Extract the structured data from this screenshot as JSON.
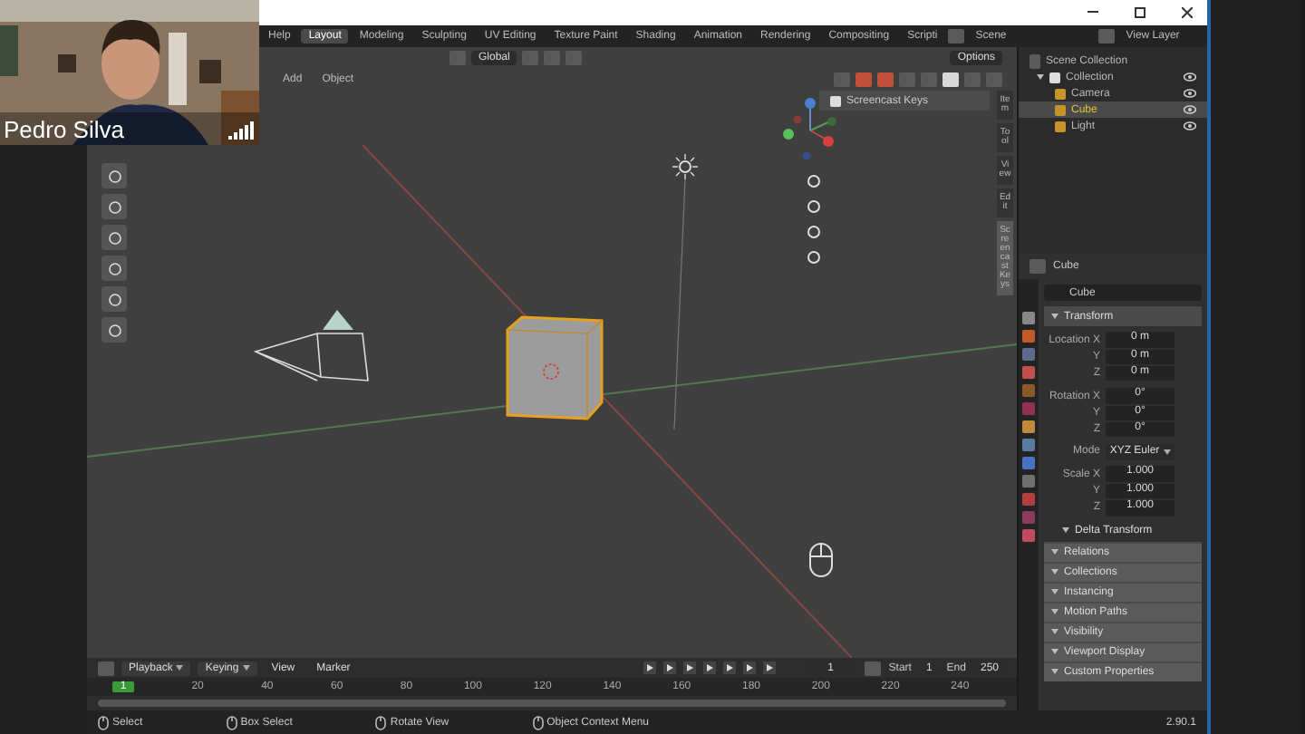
{
  "call": {
    "participant": "Pedro Silva"
  },
  "menu": [
    "Help"
  ],
  "workspaces": [
    {
      "label": "Layout",
      "selected": true
    },
    {
      "label": "Modeling",
      "selected": false
    },
    {
      "label": "Sculpting",
      "selected": false
    },
    {
      "label": "UV Editing",
      "selected": false
    },
    {
      "label": "Texture Paint",
      "selected": false
    },
    {
      "label": "Shading",
      "selected": false
    },
    {
      "label": "Animation",
      "selected": false
    },
    {
      "label": "Rendering",
      "selected": false
    },
    {
      "label": "Compositing",
      "selected": false
    },
    {
      "label": "Scripti",
      "selected": false
    }
  ],
  "scene": "Scene",
  "view_layer": "View Layer",
  "viewport": {
    "orientation": "Global",
    "options": "Options",
    "menu": [
      "Add",
      "Object"
    ],
    "screencast_keys": {
      "label": "Screencast Keys",
      "checked": true
    },
    "sidebar_tabs": [
      {
        "label": "Item",
        "selected": false
      },
      {
        "label": "Tool",
        "selected": false
      },
      {
        "label": "View",
        "selected": false
      },
      {
        "label": "Edit",
        "selected": false
      },
      {
        "label": "Screencast Keys",
        "selected": true
      }
    ]
  },
  "outliner": {
    "root": "Scene Collection",
    "items": [
      {
        "label": "Collection",
        "checked": true,
        "children": [
          {
            "label": "Camera",
            "selected": false
          },
          {
            "label": "Cube",
            "selected": true
          },
          {
            "label": "Light",
            "selected": false
          }
        ]
      }
    ]
  },
  "properties": {
    "object": "Cube",
    "name": "Cube",
    "panel": "Transform",
    "rows": [
      {
        "kind": "field",
        "label": "Location X",
        "value": "0 m"
      },
      {
        "kind": "field",
        "label": "Y",
        "value": "0 m"
      },
      {
        "kind": "field",
        "label": "Z",
        "value": "0 m"
      },
      {
        "kind": "field",
        "label": "Rotation X",
        "value": "0°"
      },
      {
        "kind": "field",
        "label": "Y",
        "value": "0°"
      },
      {
        "kind": "field",
        "label": "Z",
        "value": "0°"
      },
      {
        "kind": "dropdown",
        "label": "Mode",
        "value": "XYZ Euler"
      },
      {
        "kind": "field",
        "label": "Scale X",
        "value": "1.000"
      },
      {
        "kind": "field",
        "label": "Y",
        "value": "1.000"
      },
      {
        "kind": "field",
        "label": "Z",
        "value": "1.000"
      }
    ],
    "subpanel": "Delta Transform",
    "sections": [
      "Relations",
      "Collections",
      "Instancing",
      "Motion Paths",
      "Visibility",
      "Viewport Display",
      "Custom Properties"
    ]
  },
  "timeline": {
    "menus": [
      {
        "label": "Playback",
        "dropdown": true
      },
      {
        "label": "Keying",
        "dropdown": true
      },
      {
        "label": "View",
        "dropdown": false
      },
      {
        "label": "Marker",
        "dropdown": false
      }
    ],
    "frame": "1",
    "start_label": "Start",
    "start": "1",
    "end_label": "End",
    "end": "250",
    "current": "1",
    "ticks": [
      "20",
      "40",
      "60",
      "80",
      "100",
      "120",
      "140",
      "160",
      "180",
      "200",
      "220",
      "240"
    ]
  },
  "status_bar": {
    "items": [
      "Select",
      "Box Select",
      "Rotate View",
      "Object Context Menu"
    ],
    "version": "2.90.1"
  }
}
